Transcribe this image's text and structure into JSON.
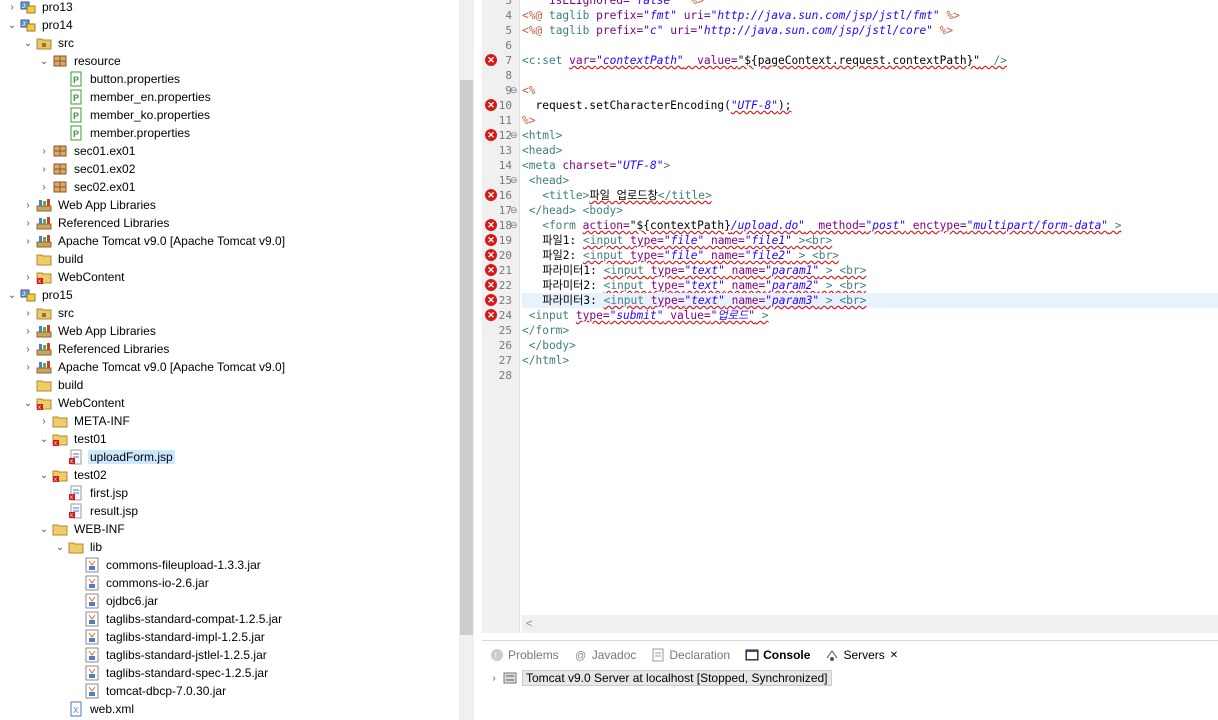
{
  "explorer": {
    "rows": [
      {
        "label": "pro13",
        "indent": 0,
        "twisty": ">",
        "icon": "project-icon"
      },
      {
        "label": "pro14",
        "indent": 0,
        "twisty": "v",
        "icon": "project-icon"
      },
      {
        "label": "src",
        "indent": 1,
        "twisty": "v",
        "icon": "source-folder-icon"
      },
      {
        "label": "resource",
        "indent": 2,
        "twisty": "v",
        "icon": "package-icon"
      },
      {
        "label": "button.properties",
        "indent": 3,
        "twisty": "",
        "icon": "properties-file-icon"
      },
      {
        "label": "member_en.properties",
        "indent": 3,
        "twisty": "",
        "icon": "properties-file-icon"
      },
      {
        "label": "member_ko.properties",
        "indent": 3,
        "twisty": "",
        "icon": "properties-file-icon"
      },
      {
        "label": "member.properties",
        "indent": 3,
        "twisty": "",
        "icon": "properties-file-icon"
      },
      {
        "label": "sec01.ex01",
        "indent": 2,
        "twisty": ">",
        "icon": "package-icon"
      },
      {
        "label": "sec01.ex02",
        "indent": 2,
        "twisty": ">",
        "icon": "package-icon"
      },
      {
        "label": "sec02.ex01",
        "indent": 2,
        "twisty": ">",
        "icon": "package-icon"
      },
      {
        "label": "Web App Libraries",
        "indent": 1,
        "twisty": ">",
        "icon": "library-icon"
      },
      {
        "label": "Referenced Libraries",
        "indent": 1,
        "twisty": ">",
        "icon": "library-icon"
      },
      {
        "label": "Apache Tomcat v9.0 [Apache Tomcat v9.0]",
        "indent": 1,
        "twisty": ">",
        "icon": "library-icon"
      },
      {
        "label": "build",
        "indent": 1,
        "twisty": "",
        "icon": "folder-icon"
      },
      {
        "label": "WebContent",
        "indent": 1,
        "twisty": ">",
        "icon": "folder-error-icon"
      },
      {
        "label": "pro15",
        "indent": 0,
        "twisty": "v",
        "icon": "project-icon"
      },
      {
        "label": "src",
        "indent": 1,
        "twisty": ">",
        "icon": "source-folder-icon"
      },
      {
        "label": "Web App Libraries",
        "indent": 1,
        "twisty": ">",
        "icon": "library-icon"
      },
      {
        "label": "Referenced Libraries",
        "indent": 1,
        "twisty": ">",
        "icon": "library-icon"
      },
      {
        "label": "Apache Tomcat v9.0 [Apache Tomcat v9.0]",
        "indent": 1,
        "twisty": ">",
        "icon": "library-icon"
      },
      {
        "label": "build",
        "indent": 1,
        "twisty": "",
        "icon": "folder-icon"
      },
      {
        "label": "WebContent",
        "indent": 1,
        "twisty": "v",
        "icon": "folder-error-icon"
      },
      {
        "label": "META-INF",
        "indent": 2,
        "twisty": ">",
        "icon": "folder-icon"
      },
      {
        "label": "test01",
        "indent": 2,
        "twisty": "v",
        "icon": "folder-error-icon"
      },
      {
        "label": "uploadForm.jsp",
        "indent": 3,
        "twisty": "",
        "icon": "jsp-error-icon",
        "selected": true
      },
      {
        "label": "test02",
        "indent": 2,
        "twisty": "v",
        "icon": "folder-error-icon"
      },
      {
        "label": "first.jsp",
        "indent": 3,
        "twisty": "",
        "icon": "jsp-error-icon"
      },
      {
        "label": "result.jsp",
        "indent": 3,
        "twisty": "",
        "icon": "jsp-error-icon"
      },
      {
        "label": "WEB-INF",
        "indent": 2,
        "twisty": "v",
        "icon": "folder-icon"
      },
      {
        "label": "lib",
        "indent": 3,
        "twisty": "v",
        "icon": "folder-icon"
      },
      {
        "label": "commons-fileupload-1.3.3.jar",
        "indent": 4,
        "twisty": "",
        "icon": "jar-icon"
      },
      {
        "label": "commons-io-2.6.jar",
        "indent": 4,
        "twisty": "",
        "icon": "jar-icon"
      },
      {
        "label": "ojdbc6.jar",
        "indent": 4,
        "twisty": "",
        "icon": "jar-icon"
      },
      {
        "label": "taglibs-standard-compat-1.2.5.jar",
        "indent": 4,
        "twisty": "",
        "icon": "jar-icon"
      },
      {
        "label": "taglibs-standard-impl-1.2.5.jar",
        "indent": 4,
        "twisty": "",
        "icon": "jar-icon"
      },
      {
        "label": "taglibs-standard-jstlel-1.2.5.jar",
        "indent": 4,
        "twisty": "",
        "icon": "jar-icon"
      },
      {
        "label": "taglibs-standard-spec-1.2.5.jar",
        "indent": 4,
        "twisty": "",
        "icon": "jar-icon"
      },
      {
        "label": "tomcat-dbcp-7.0.30.jar",
        "indent": 4,
        "twisty": "",
        "icon": "jar-icon"
      },
      {
        "label": "web.xml",
        "indent": 3,
        "twisty": "",
        "icon": "xml-file-icon"
      }
    ]
  },
  "editor": {
    "lines": [
      {
        "n": "3",
        "err": false,
        "fold": "",
        "html": [
          [
            "an",
            "    isELIgnored="
          ],
          [
            "av",
            "\"false\""
          ],
          [
            "dir",
            "  %>"
          ]
        ]
      },
      {
        "n": "4",
        "err": false,
        "fold": "",
        "html": [
          [
            "dir",
            "<%@ "
          ],
          [
            "tag",
            "taglib "
          ],
          [
            "an",
            "prefix="
          ],
          [
            "av",
            "\"fmt\""
          ],
          [
            "an",
            " uri="
          ],
          [
            "av",
            "\"http://java.sun.com/jsp/jstl/fmt\""
          ],
          [
            "dir",
            " %>"
          ]
        ]
      },
      {
        "n": "5",
        "err": false,
        "fold": "",
        "html": [
          [
            "dir",
            "<%@ "
          ],
          [
            "tag",
            "taglib "
          ],
          [
            "an",
            "prefix="
          ],
          [
            "av",
            "\"c\""
          ],
          [
            "an",
            " uri="
          ],
          [
            "av",
            "\"http://java.sun.com/jsp/jstl/core\""
          ],
          [
            "dir",
            " %>"
          ]
        ]
      },
      {
        "n": "6",
        "err": false,
        "fold": "",
        "html": []
      },
      {
        "n": "7",
        "err": true,
        "fold": "",
        "html": [
          [
            "tag",
            "<c:set "
          ],
          [
            "an",
            "var="
          ],
          [
            "av",
            "\"contextPath\""
          ],
          [
            "an",
            "  value="
          ],
          [
            "plain",
            "\"${pageContext.request.contextPath}\""
          ],
          [
            "tag",
            "  />"
          ]
        ]
      },
      {
        "n": "8",
        "err": false,
        "fold": "",
        "html": []
      },
      {
        "n": "9",
        "err": false,
        "fold": "⊖",
        "html": [
          [
            "dir",
            "<%"
          ]
        ]
      },
      {
        "n": "10",
        "err": true,
        "fold": "",
        "html": [
          [
            "plain",
            "  request.setCharacterEncoding("
          ],
          [
            "av",
            "\"UTF-8\""
          ],
          [
            "plain",
            ");"
          ]
        ]
      },
      {
        "n": "11",
        "err": false,
        "fold": "",
        "html": [
          [
            "dir",
            "%>"
          ]
        ]
      },
      {
        "n": "12",
        "err": true,
        "fold": "⊖",
        "html": [
          [
            "tag",
            "<html>"
          ]
        ]
      },
      {
        "n": "13",
        "err": false,
        "fold": "",
        "html": [
          [
            "tag",
            "<head>"
          ]
        ]
      },
      {
        "n": "14",
        "err": false,
        "fold": "",
        "html": [
          [
            "tag",
            "<meta "
          ],
          [
            "an",
            "charset="
          ],
          [
            "av",
            "\"UTF-8\""
          ],
          [
            "tag",
            ">"
          ]
        ]
      },
      {
        "n": "15",
        "err": false,
        "fold": "⊖",
        "html": [
          [
            "tag",
            " <head>"
          ]
        ]
      },
      {
        "n": "16",
        "err": true,
        "fold": "",
        "html": [
          [
            "tag",
            "   <title>"
          ],
          [
            "plain",
            "파일 업로드창"
          ],
          [
            "tag",
            "</title>"
          ]
        ]
      },
      {
        "n": "17",
        "err": false,
        "fold": "⊖",
        "html": [
          [
            "tag",
            " </head> <body>"
          ]
        ]
      },
      {
        "n": "18",
        "err": true,
        "fold": "⊖",
        "html": [
          [
            "tag",
            "   <form "
          ],
          [
            "an",
            "action="
          ],
          [
            "plain",
            "\"${contextPath}"
          ],
          [
            "av",
            "/upload.do\""
          ],
          [
            "an",
            "  method="
          ],
          [
            "av",
            "\"post\""
          ],
          [
            "an",
            " enctype="
          ],
          [
            "av",
            "\"multipart/form-data\""
          ],
          [
            "tag",
            " >"
          ]
        ]
      },
      {
        "n": "19",
        "err": true,
        "fold": "",
        "html": [
          [
            "plain",
            "   파일1: "
          ],
          [
            "tag",
            "<input "
          ],
          [
            "an",
            "type="
          ],
          [
            "av",
            "\"file\""
          ],
          [
            "an",
            " name="
          ],
          [
            "av",
            "\"file1\""
          ],
          [
            "tag",
            " ><br>"
          ]
        ]
      },
      {
        "n": "20",
        "err": true,
        "fold": "",
        "html": [
          [
            "plain",
            "   파일2: "
          ],
          [
            "tag",
            "<input "
          ],
          [
            "an",
            "type="
          ],
          [
            "av",
            "\"file\""
          ],
          [
            "an",
            " name="
          ],
          [
            "av",
            "\"file2\""
          ],
          [
            "tag",
            " > <br>"
          ]
        ]
      },
      {
        "n": "21",
        "err": true,
        "fold": "",
        "html": [
          [
            "plain",
            "   파라미터1: "
          ],
          [
            "tag",
            "<input "
          ],
          [
            "an",
            "type="
          ],
          [
            "av",
            "\"text\""
          ],
          [
            "an",
            " name="
          ],
          [
            "av",
            "\"param1\""
          ],
          [
            "tag",
            " > <br>"
          ]
        ]
      },
      {
        "n": "22",
        "err": true,
        "fold": "",
        "html": [
          [
            "plain",
            "   파라미터2: "
          ],
          [
            "tag",
            "<input "
          ],
          [
            "an",
            "type="
          ],
          [
            "av",
            "\"text\""
          ],
          [
            "an",
            " name="
          ],
          [
            "av",
            "\"param2\""
          ],
          [
            "tag",
            " > <br>"
          ]
        ]
      },
      {
        "n": "23",
        "err": true,
        "fold": "",
        "hl": true,
        "html": [
          [
            "plain",
            "   파라미터3: "
          ],
          [
            "tag",
            "<input "
          ],
          [
            "an",
            "type="
          ],
          [
            "av",
            "\"text\""
          ],
          [
            "an",
            " name="
          ],
          [
            "av",
            "\"param3\""
          ],
          [
            "tag",
            " > <br>"
          ]
        ]
      },
      {
        "n": "24",
        "err": true,
        "fold": "",
        "html": [
          [
            "tag",
            " <input "
          ],
          [
            "an",
            "type="
          ],
          [
            "av",
            "\"submit\""
          ],
          [
            "an",
            " value="
          ],
          [
            "av",
            "\"업로드\""
          ],
          [
            "tag",
            " >"
          ]
        ]
      },
      {
        "n": "25",
        "err": false,
        "fold": "",
        "html": [
          [
            "tag",
            "</form>"
          ]
        ]
      },
      {
        "n": "26",
        "err": false,
        "fold": "",
        "html": [
          [
            "tag",
            " </body>"
          ]
        ]
      },
      {
        "n": "27",
        "err": false,
        "fold": "",
        "html": [
          [
            "tag",
            "</html>"
          ]
        ]
      },
      {
        "n": "28",
        "err": false,
        "fold": "",
        "html": []
      }
    ]
  },
  "bottom": {
    "tabs": [
      {
        "label": "Problems",
        "icon": "problems-icon",
        "active": false
      },
      {
        "label": "Javadoc",
        "icon": "javadoc-icon",
        "active": false
      },
      {
        "label": "Declaration",
        "icon": "declaration-icon",
        "active": false
      },
      {
        "label": "Console",
        "icon": "console-icon",
        "active": true
      },
      {
        "label": "Servers",
        "icon": "servers-icon",
        "active": false,
        "selected": true,
        "close": "✕"
      }
    ],
    "server_label": "Tomcat v9.0 Server at localhost  [Stopped, Synchronized]"
  }
}
